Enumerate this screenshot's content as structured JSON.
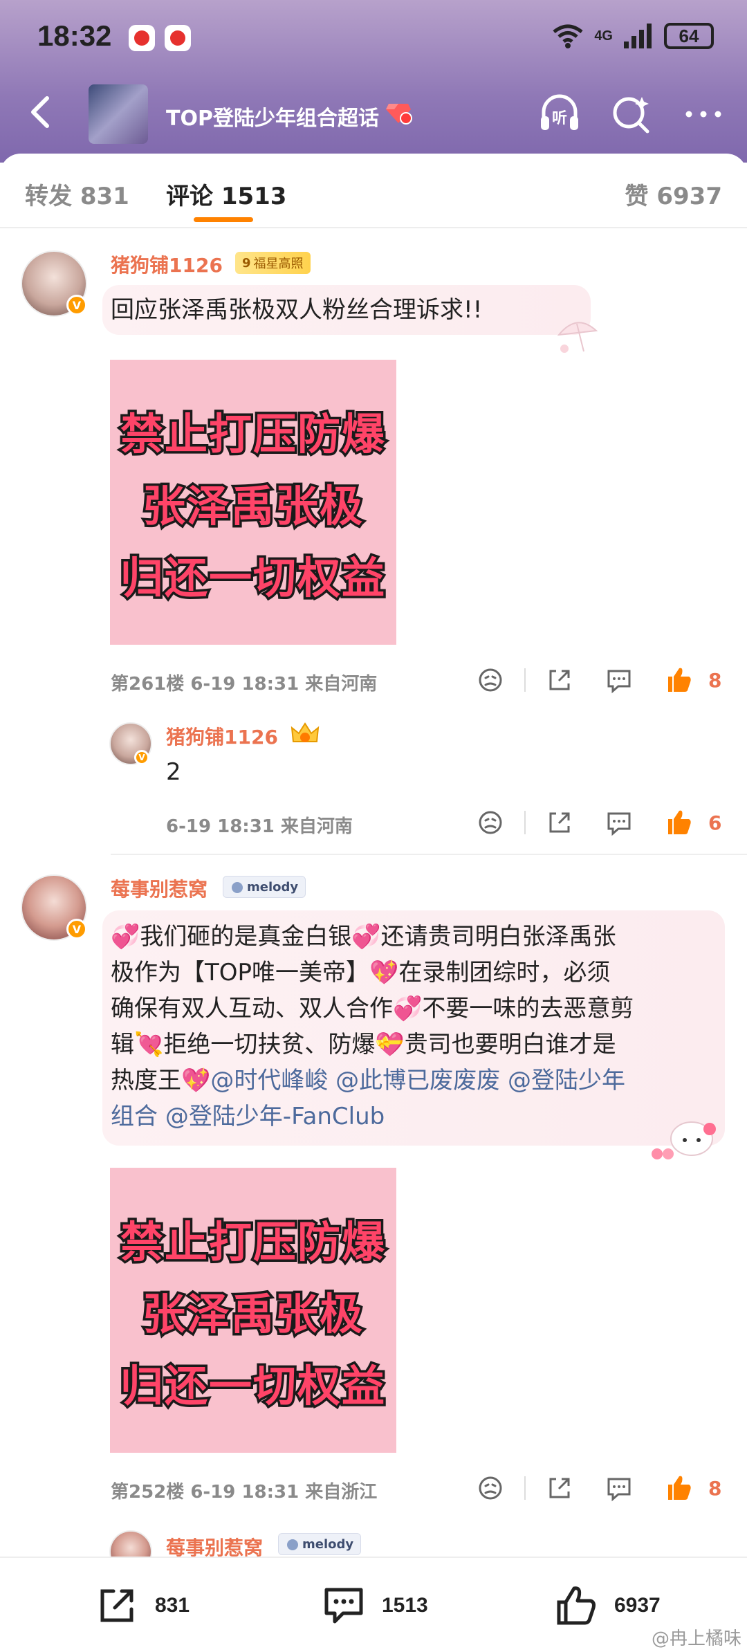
{
  "status_bar": {
    "time": "18:32",
    "network": "4G",
    "battery": "64"
  },
  "nav": {
    "title": "TOP登陆少年组合超话"
  },
  "tabs": {
    "repost": "转发 831",
    "comment": "评论 1513",
    "like": "赞 6937"
  },
  "comments": [
    {
      "username": "猪狗铺1126",
      "badge": "福星高照",
      "badge_level": "9",
      "text": "回应张泽禹张极双人粉丝合理诉求!!",
      "image_lines": [
        "禁止打压防爆",
        "张泽禹张极",
        "归还一切权益"
      ],
      "meta": "第261楼  6-19 18:31  来自河南",
      "likes": "8",
      "reply": {
        "username": "猪狗铺1126",
        "text": "2",
        "meta": "6-19 18:31  来自河南",
        "likes": "6"
      }
    },
    {
      "username": "莓事别惹窝",
      "badge": "melody",
      "text_parts": {
        "p1": "💞我们砸的是真金白银💞还请贵司明白张泽禹张",
        "p2": "极作为【TOP唯一美帝】💖在录制团综时，必须",
        "p3": "确保有双人互动、双人合作💞不要一味的去恶意剪",
        "p4": "辑💘拒绝一切扶贫、防爆💝贵司也要明白谁才是",
        "p5_text": "热度王💖",
        "m1": "@时代峰峻",
        "m2": "@此博已废废废",
        "m3": "@登陆少年",
        "m4": "组合",
        "m5": "@登陆少年-FanClub"
      },
      "image_lines": [
        "禁止打压防爆",
        "张泽禹张极",
        "归还一切权益"
      ],
      "meta": "第252楼  6-19 18:31  来自浙江",
      "likes": "8",
      "next_username": "莓事别惹窝",
      "next_badge": "melody"
    }
  ],
  "bottom": {
    "repost": "831",
    "comment": "1513",
    "like": "6937"
  },
  "watermark": "@冉上橘味",
  "colors": {
    "accent": "#ff8200",
    "username": "#eb7350",
    "mention": "#4d6a9c"
  }
}
